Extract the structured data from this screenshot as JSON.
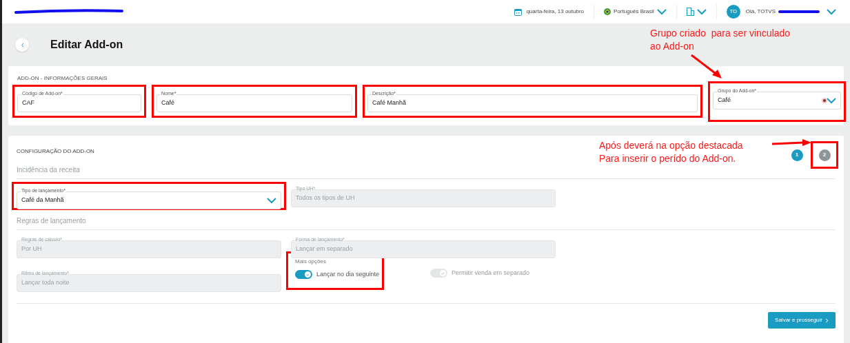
{
  "header": {
    "date": "quarta-feira, 13 outubro",
    "language": "Português Brasil",
    "avatar": "TD",
    "greeting": "Olá, TOTVS"
  },
  "page_title": "Editar Add-on",
  "general": {
    "title": "ADD-ON - INFORMAÇÕES GERAIS",
    "fields": [
      {
        "kind": "text",
        "label": "Código de Add-on*",
        "value": "CAF",
        "highlighted": true
      },
      {
        "kind": "text",
        "label": "Nome*",
        "value": "Café",
        "highlighted": true
      },
      {
        "kind": "text",
        "label": "Descrição*",
        "value": "Café Manhã",
        "highlighted": true
      },
      {
        "kind": "select",
        "label": "Grupo do Add-on*",
        "value": "Café",
        "highlighted": true
      }
    ]
  },
  "config": {
    "title": "CONFIGURAÇÃO DO ADD-ON",
    "steps": [
      {
        "label": "1",
        "selected": true,
        "highlighted": false
      },
      {
        "label": "2",
        "selected": false,
        "highlighted": true
      }
    ],
    "groups": [
      {
        "title": "Incidência da receita",
        "fields": [
          {
            "kind": "select",
            "label": "Tipo de lançamento*",
            "value": "Café da Manhã",
            "disabled": false,
            "highlighted": true
          },
          {
            "kind": "text",
            "label": "Tipo UH*",
            "value": "Todos os tipos de UH",
            "disabled": true,
            "highlighted": false
          }
        ]
      },
      {
        "title": "Regras de lançamento",
        "fields": [
          {
            "kind": "text",
            "label": "Regras de cálculo*",
            "value": "Por UH",
            "disabled": true,
            "highlighted": false
          },
          {
            "kind": "text",
            "label": "Forma de lançamento*",
            "value": "Lançar em separado",
            "disabled": true,
            "highlighted": false
          },
          {
            "kind": "text",
            "label": "Ritmo de lançamento*",
            "value": "Lançar toda noite",
            "disabled": true,
            "highlighted": false
          }
        ]
      }
    ],
    "options": {
      "title": "Mais opções",
      "toggles": [
        {
          "label": "Lançar no dia seguinte",
          "on": true,
          "disabled": false,
          "highlighted": true
        },
        {
          "label": "Permitir venda em separado",
          "on": true,
          "disabled": true,
          "highlighted": false
        }
      ]
    },
    "submit": "Salvar e prosseguir"
  },
  "annotations": [
    {
      "lines": [
        "Grupo criado  para ser vinculado",
        "ao Add-on"
      ]
    },
    {
      "lines": [
        "Após deverá na opção destacada",
        "Para inserir o perído do Add-on."
      ]
    }
  ]
}
